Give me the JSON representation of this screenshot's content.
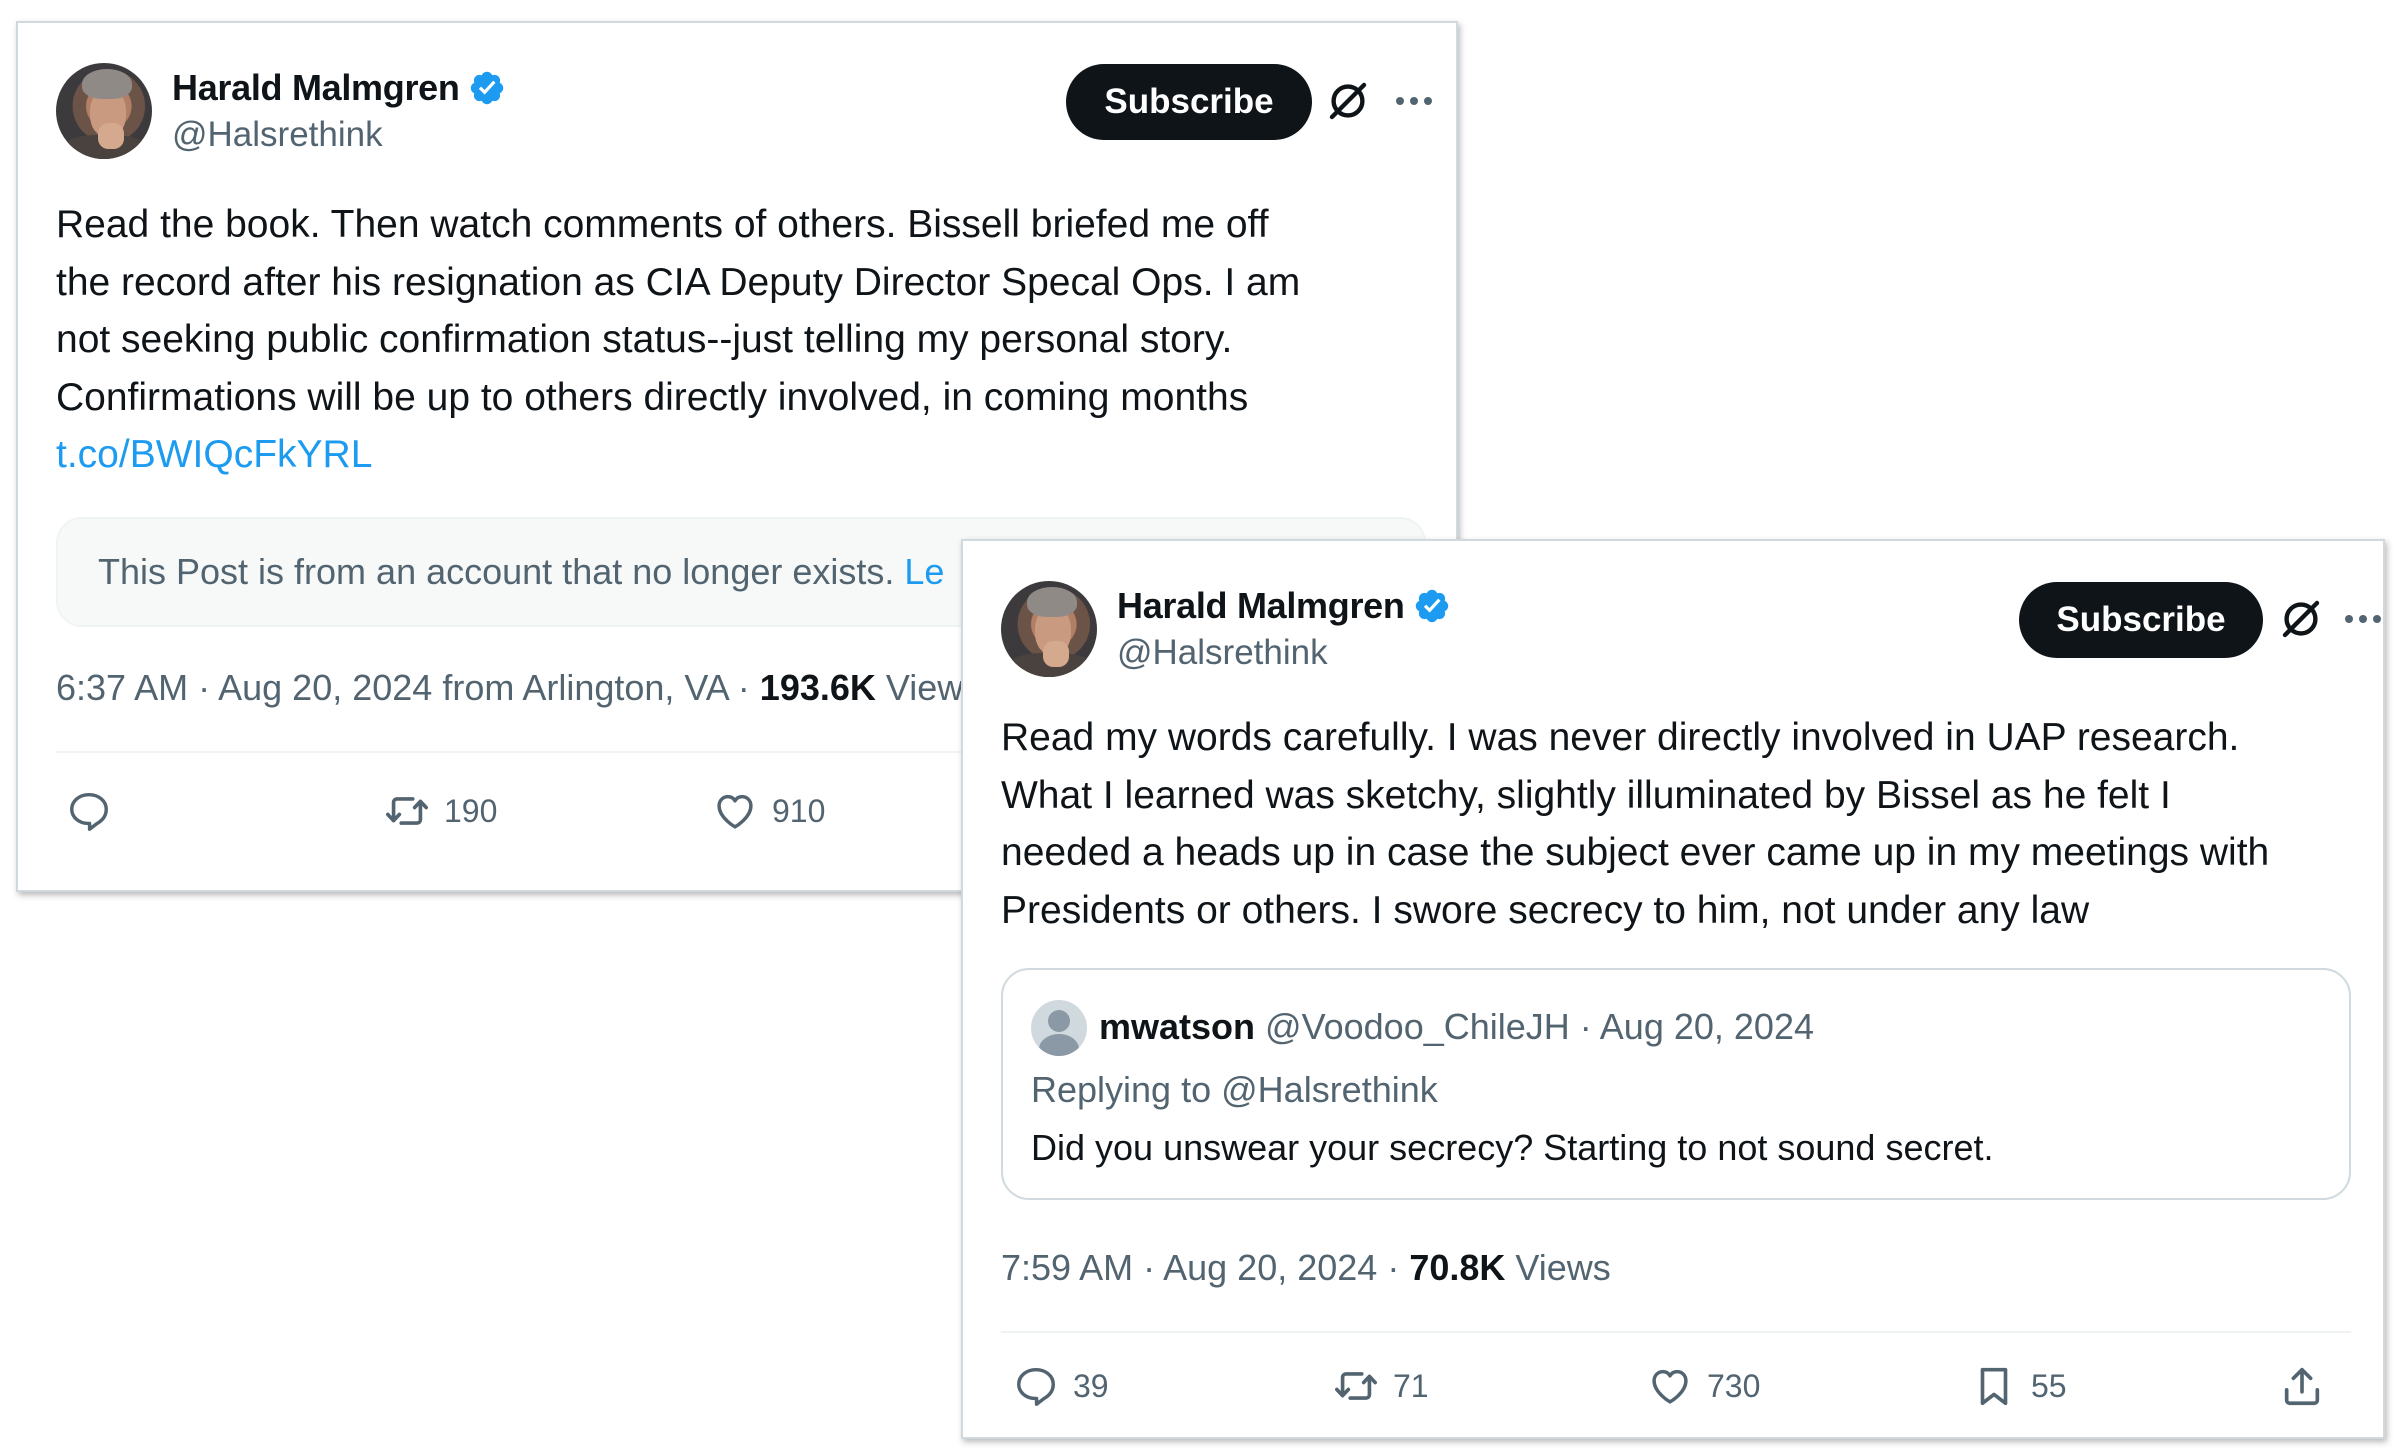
{
  "tweets": [
    {
      "author_name": "Harald Malmgren",
      "handle": "@Halsrethink",
      "subscribe_label": "Subscribe",
      "lines": [
        "Read the book. Then watch comments of others. Bissell briefed me off",
        "the record after his resignation as CIA Deputy Director Specal Ops. I am",
        "not seeking public confirmation status--just telling my personal story.",
        "Confirmations will be up to others directly involved, in coming months"
      ],
      "link": "t.co/BWIQcFkYRL",
      "notice": "This Post is from an account that no longer exists.",
      "notice_learn": "Le",
      "time": "6:37 AM",
      "date": "Aug 20, 2024",
      "location": "from Arlington, VA",
      "views_count": "193.6K",
      "views_label": "View",
      "retweets": "190",
      "likes": "910"
    },
    {
      "author_name": "Harald Malmgren",
      "handle": "@Halsrethink",
      "subscribe_label": "Subscribe",
      "lines": [
        "Read my words carefully. I was never directly involved in UAP research.",
        "What I learned was sketchy, slightly illuminated by Bissel as he felt I",
        "needed a heads up in case the subject ever came up in my meetings with",
        "Presidents or others. I swore secrecy to him, not under any law"
      ],
      "quote": {
        "name": "mwatson",
        "handle": "@Voodoo_ChileJH",
        "date": "Aug 20, 2024",
        "replying_prefix": "Replying to",
        "replying_to": "@Halsrethink",
        "text": "Did you unswear your secrecy? Starting to not sound secret."
      },
      "time": "7:59 AM",
      "date": "Aug 20, 2024",
      "views_count": "70.8K",
      "views_label": "Views",
      "replies": "39",
      "retweets": "71",
      "likes": "730",
      "bookmarks": "55"
    }
  ],
  "colors": {
    "text": "#0f1419",
    "secondary": "#536471",
    "link": "#1d9bf0",
    "verified": "#1d9bf0",
    "button": "#0f1419"
  },
  "icons": [
    "verified-badge-icon",
    "grok-icon",
    "more-icon",
    "reply-icon",
    "retweet-icon",
    "like-icon",
    "bookmark-icon",
    "share-icon"
  ]
}
